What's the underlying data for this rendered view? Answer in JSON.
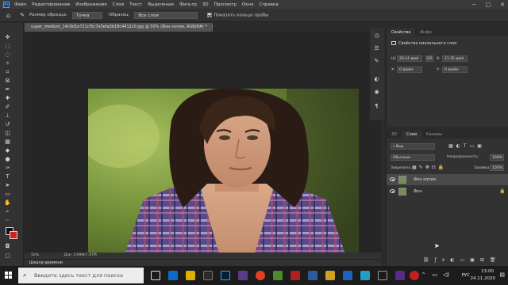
{
  "menu": {
    "logo": "Ps",
    "items": [
      "Файл",
      "Редактирование",
      "Изображение",
      "Слои",
      "Текст",
      "Выделение",
      "Фильтр",
      "3D",
      "Просмотр",
      "Окно",
      "Справка"
    ],
    "window_minimize": "─",
    "window_maximize": "□",
    "window_close": "✕"
  },
  "options": {
    "sample_size_label": "Размер образца:",
    "sample_size_value": "Точка",
    "sample_label": "Образец:",
    "sample_value": "Все слои",
    "show_ring_label": "Показать кольцо пробы"
  },
  "document": {
    "tab_title": "super_medium_14c6d1e721cf5c7a5efa3b18c4412c0.jpg @ 50% (Фон копия, RGB/8#) *",
    "tab_close": "×",
    "zoom": "50%",
    "doc_info": "Док: 3,99M/7,97M",
    "timeline_label": "Шкала времени"
  },
  "properties": {
    "tabs": [
      "Свойства",
      "Инфо"
    ],
    "header": "Свойства пиксельного слоя",
    "w_label": "Ш:",
    "w_value": "20,14 дюй",
    "link_label": "GO",
    "h_label": "В:",
    "h_value": "11,35 дюй",
    "x_label": "X:",
    "x_value": "0 дюйм",
    "y_label": "Y:",
    "y_value": "0 дюйм"
  },
  "layers": {
    "tabs": [
      "3D",
      "Слои",
      "Каналы"
    ],
    "kind_value": "Вид",
    "blend_value": "Обычные",
    "opacity_label": "Непрозрачность:",
    "opacity_value": "100%",
    "lock_label": "Закрепить:",
    "fill_label": "Заливка:",
    "fill_value": "100%",
    "items": [
      {
        "name": "Фон копия"
      },
      {
        "name": "Фон"
      }
    ]
  },
  "taskbar": {
    "search_placeholder": "Введите здесь текст для поиска",
    "language": "РУС",
    "time": "13:00",
    "date": "24.11.2020"
  }
}
